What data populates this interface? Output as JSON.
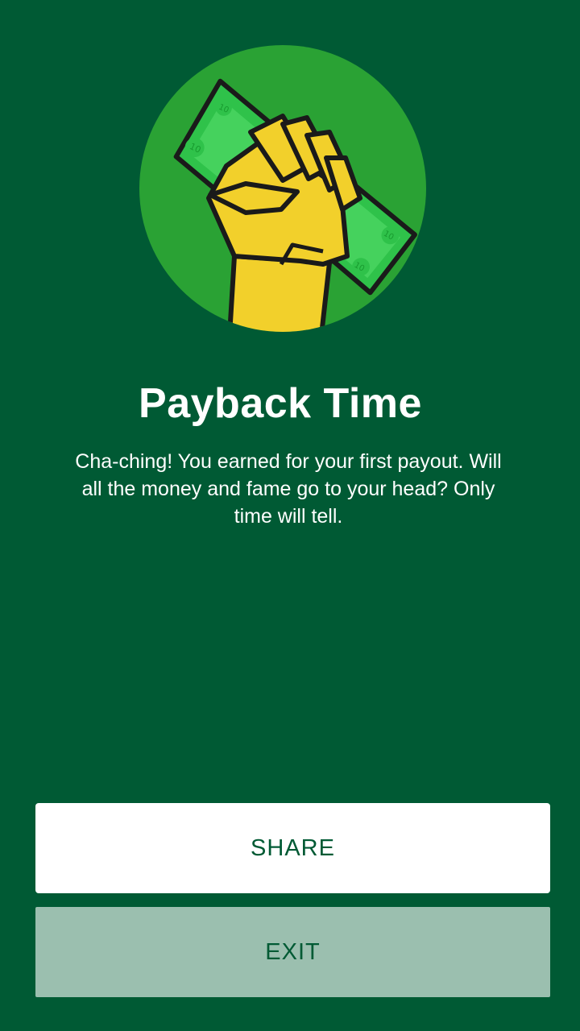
{
  "badge": {
    "icon": "fist-holding-money-icon",
    "circle_color": "#2aa234",
    "bill_denomination": "10"
  },
  "title": "Payback Time",
  "description": "Cha-ching! You earned for your first payout. Will all the money and fame go to your head? Only time will tell.",
  "buttons": {
    "share_label": "SHARE",
    "exit_label": "EXIT"
  },
  "colors": {
    "background": "#005a34",
    "share_bg": "#ffffff",
    "exit_bg": "#9bbfaf",
    "button_text": "#005a34"
  }
}
